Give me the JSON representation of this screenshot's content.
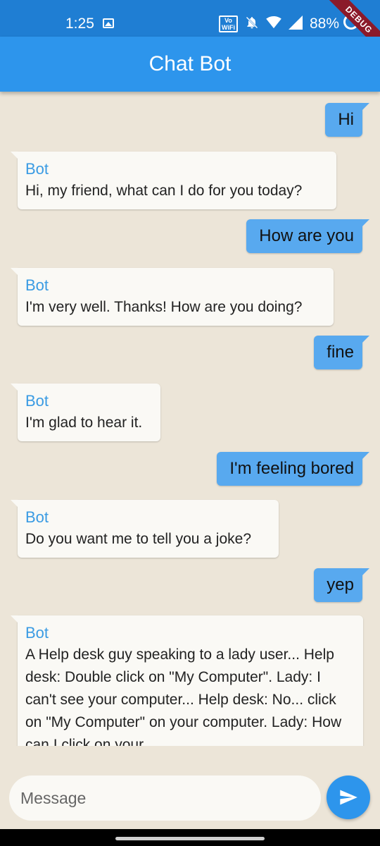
{
  "status_bar": {
    "time": "1:25",
    "vowifi": "Vo\nWiFi",
    "battery": "88%",
    "debug_label": "DEBUG",
    "icons": [
      "image-icon",
      "vowifi-icon",
      "mute-bell-icon",
      "wifi-icon",
      "signal-icon",
      "battery-icon"
    ]
  },
  "app_bar": {
    "title": "Chat Bot"
  },
  "messages": [
    {
      "from": "user",
      "text": "Hi"
    },
    {
      "from": "bot",
      "name": "Bot",
      "text": "Hi, my friend, what can I do for you today?"
    },
    {
      "from": "user",
      "text": "How are you"
    },
    {
      "from": "bot",
      "name": "Bot",
      "text": "I'm very well. Thanks! How are you doing?"
    },
    {
      "from": "user",
      "text": "fine"
    },
    {
      "from": "bot",
      "name": "Bot",
      "text": "I'm glad to hear it."
    },
    {
      "from": "user",
      "text": "I'm feeling bored"
    },
    {
      "from": "bot",
      "name": "Bot",
      "text": "Do you want me to tell you a joke?"
    },
    {
      "from": "user",
      "text": "yep"
    },
    {
      "from": "bot",
      "name": "Bot",
      "text": "A Help desk guy speaking to a lady user... Help desk: Double click on \"My Computer\". Lady: I can't see your computer... Help desk: No... click on \"My Computer\" on your computer. Lady: How can I click on your"
    }
  ],
  "input": {
    "placeholder": "Message",
    "value": ""
  },
  "colors": {
    "status_bar": "#1f7ed3",
    "app_bar": "#2d95ec",
    "user_bubble": "#58a9ef",
    "bot_bubble": "#faf9f5",
    "bot_name": "#3a9be3",
    "background": "#ece5d8"
  }
}
